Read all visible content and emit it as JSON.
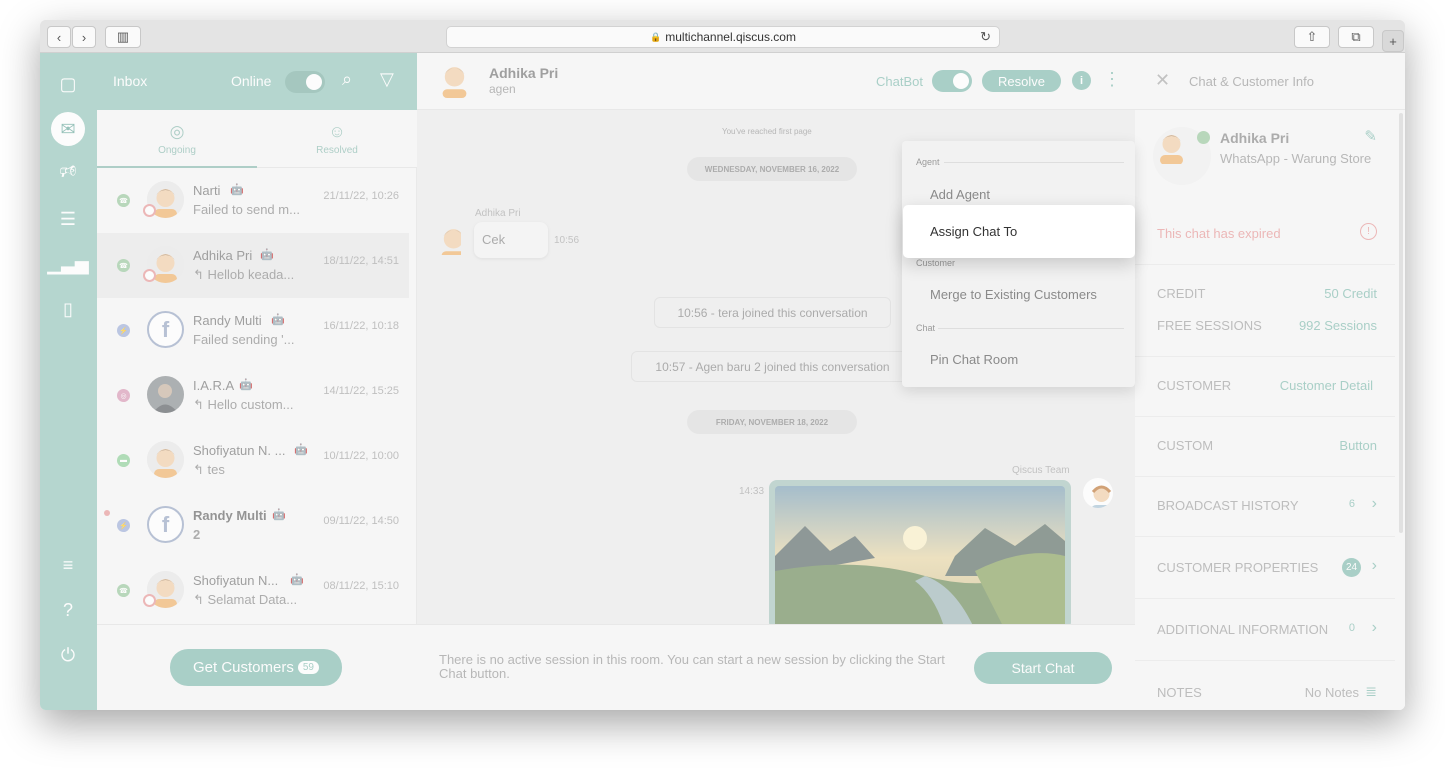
{
  "browser": {
    "url": "multichannel.qiscus.com",
    "back_icon": "chevron-left-icon",
    "forward_icon": "chevron-right-icon"
  },
  "inbox": {
    "title": "Inbox",
    "online_label": "Online",
    "tabs": [
      {
        "label": "Ongoing",
        "icon": "user-circle-icon"
      },
      {
        "label": "Resolved",
        "icon": "user-check-icon"
      }
    ],
    "rooms": [
      {
        "name": "Narti",
        "preview": "Failed to send m...",
        "time": "21/11/22, 10:26",
        "channel": "whatsapp",
        "channel_color": "#9bc9a0"
      },
      {
        "name": "Adhika Pri",
        "preview": "Hellob keada...",
        "time": "18/11/22, 14:51",
        "channel": "whatsapp",
        "channel_color": "#9bc9a0"
      },
      {
        "name": "Randy Multi",
        "preview": "Failed sending '...",
        "time": "16/11/22, 10:18",
        "channel": "messenger",
        "channel_color": "#9fb0d9"
      },
      {
        "name": "I.A.R.A",
        "preview": "Hello custom...",
        "time": "14/11/22, 15:25",
        "channel": "instagram",
        "channel_color": "#d99ab5"
      },
      {
        "name": "Shofiyatun N. ...",
        "preview": "tes",
        "time": "10/11/22, 10:00",
        "channel": "line",
        "channel_color": "#8fd09a"
      },
      {
        "name": "Randy Multi",
        "preview": "2",
        "time": "09/11/22, 14:50",
        "channel": "messenger",
        "channel_color": "#9fb0d9"
      },
      {
        "name": "Shofiyatun N...",
        "preview": "Selamat Data...",
        "time": "08/11/22, 15:10",
        "channel": "whatsapp",
        "channel_color": "#9bc9a0"
      }
    ],
    "get_customers_label": "Get Customers",
    "get_customers_count": "59"
  },
  "chat": {
    "name": "Adhika Pri",
    "subtitle": "agen",
    "chatbot_label": "ChatBot",
    "resolve_label": "Resolve",
    "reached_first": "You've reached first page",
    "date_1": "WEDNESDAY, NOVEMBER 16, 2022",
    "sender_1": "Adhika Pri",
    "message_1": "Cek",
    "time_1": "10:56",
    "system_1": "10:56 - tera joined this conversation",
    "system_2": "10:57 - Agen baru 2 joined this conversation",
    "date_2": "FRIDAY, NOVEMBER 18, 2022",
    "sender_2": "Qiscus Team",
    "time_2": "14:33",
    "composer_text": "There is no active session in this room. You can start a new session by clicking the Start Chat button.",
    "start_chat_label": "Start Chat"
  },
  "menu": {
    "group_agent": "Agent",
    "add_agent": "Add Agent",
    "assign_chat": "Assign Chat To",
    "group_customer": "Customer",
    "merge": "Merge to Existing Customers",
    "group_chat": "Chat",
    "pin": "Pin Chat Room"
  },
  "info": {
    "title": "Chat & Customer Info",
    "name": "Adhika Pri",
    "channel": "WhatsApp - Warung Store",
    "expired": "This chat has expired",
    "credit_label": "CREDIT",
    "credit_value": "50 Credit",
    "free_label": "FREE SESSIONS",
    "free_value": "992 Sessions",
    "customer_label": "CUSTOMER",
    "customer_value": "Customer Detail",
    "custom_label": "CUSTOM",
    "custom_value": "Button",
    "broadcast_label": "BROADCAST HISTORY",
    "broadcast_value": "6",
    "properties_label": "CUSTOMER PROPERTIES",
    "properties_value": "24",
    "additional_label": "ADDITIONAL INFORMATION",
    "additional_value": "0",
    "notes_label": "NOTES",
    "notes_value": "No Notes"
  },
  "colors": {
    "brand": "#85bdb1",
    "rail": "#97c8bd",
    "alert": "#e79a9a"
  }
}
